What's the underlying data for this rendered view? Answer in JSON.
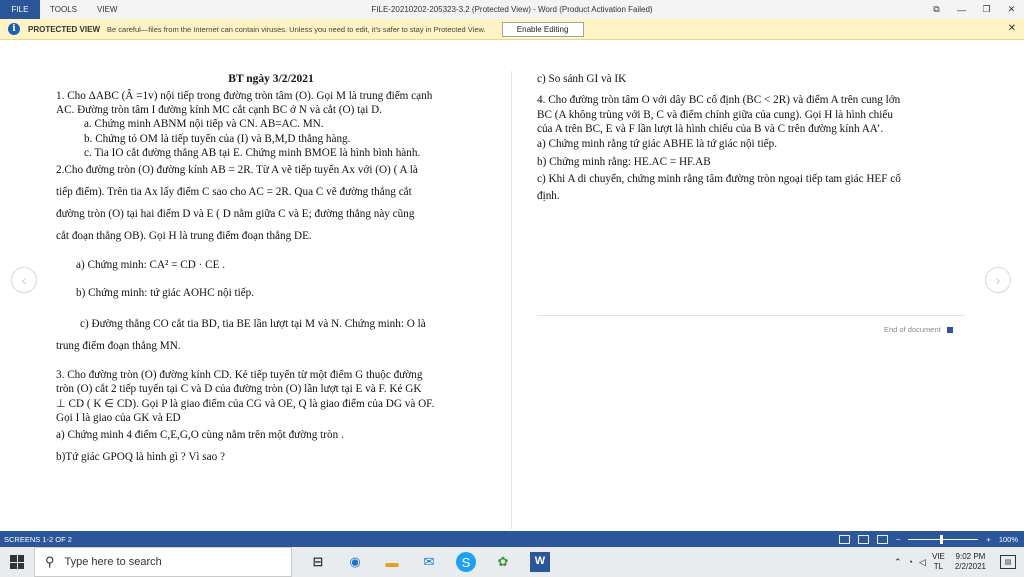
{
  "titlebar": {
    "tabs": [
      "FILE",
      "TOOLS",
      "VIEW"
    ],
    "title": "FILE-20210202-205323-3.2 (Protected View) - Word (Product Activation Failed)",
    "restore_icon": "⧉",
    "minimize_icon": "—",
    "maximize_icon": "❐",
    "close_icon": "✕"
  },
  "protected_bar": {
    "icon": "i",
    "label": "PROTECTED VIEW",
    "message": "Be careful—files from the Internet can contain viruses. Unless you need to edit, it's safer to stay in Protected View.",
    "button": "Enable Editing",
    "close": "✕"
  },
  "document": {
    "left": {
      "title": "BT ngày 3/2/2021",
      "lines": [
        "1. Cho ΔABC (Â =1v) nội tiếp trong đường tròn tâm (O). Gọi M là trung điểm cạnh",
        "AC. Đường tròn tâm I đường kính MC cắt cạnh BC ở N và cắt (O) tại D.",
        "a. Chứng minh ABNM nội tiếp và CN. AB=AC. MN.",
        "b. Chứng tỏ OM là tiếp tuyến của (I) và B,M,D thẳng hàng.",
        "c. Tia IO cắt đường thẳng AB tại E. Chứng minh BMOE là hình bình hành.",
        "2.Cho đường tròn (O) đường kính AB = 2R. Từ A vẽ tiếp tuyến Ax với (O) ( A là",
        "tiếp điểm). Trên tia Ax lấy điểm C sao cho AC = 2R. Qua C vẽ đường thẳng cắt",
        "đường tròn (O) tại hai điểm D và E ( D nằm giữa C và E; đường thẳng này cũng",
        "cắt đoạn thẳng OB). Gọi H là trung điểm đoạn thẳng DE.",
        "a)  Chứng minh:  CA² = CD · CE .",
        "b)  Chứng minh: tứ giác AOHC nội tiếp.",
        "c) Đường thẳng CO cắt tia BD, tia BE lần lượt tại M và N. Chứng minh: O là",
        "trung điểm đoạn thẳng MN.",
        "3. Cho đường tròn (O) đường kính CD. Kẻ tiếp tuyến từ một điểm G thuộc đường",
        "tròn (O) cắt 2 tiếp tuyến tại C và D của đường tròn (O) lần lượt tại E và F. Kẻ GK",
        "⊥ CD ( K ∈ CD). Gọi P là giao điểm của CG và OE, Q là giao điểm của DG và OF.",
        "Gọi I là giao của GK và ED",
        "a) Chứng minh 4 điểm C,E,G,O cùng nằm trên một đường tròn .",
        "b)Tứ giác GPOQ là hình gì ? Vì sao ?"
      ]
    },
    "right": {
      "lines": [
        "c) So sánh GI và IK",
        "4. Cho đường tròn tâm O với dây BC cố định (BC < 2R) và điểm A trên cung lớn",
        "BC (A không trùng với B, C và điểm chính giữa của cung). Gọi H là hình chiếu",
        "của A trên BC, E và F lần lượt là hình chiếu của B và C trên đường kính AA’.",
        "a) Chứng minh rằng tứ giác ABHE là tứ giác nội tiếp.",
        "b) Chứng minh rằng: HE.AC = HF.AB",
        "c) Khi A di chuyển, chứng minh rằng tâm đường tròn ngoại tiếp tam giác HEF cố",
        "định."
      ],
      "end_label": "End of document"
    },
    "nav_prev": "‹",
    "nav_next": "›"
  },
  "statusbar": {
    "screens": "SCREENS 1-2 OF 2",
    "zoom_minus": "−",
    "zoom_plus": "+",
    "zoom": "100%"
  },
  "taskbar": {
    "search_placeholder": "Type here to search",
    "search_icon": "⚲",
    "language": [
      "VIE",
      "TL"
    ],
    "time": "9:02 PM",
    "date": "2/2/2021"
  }
}
